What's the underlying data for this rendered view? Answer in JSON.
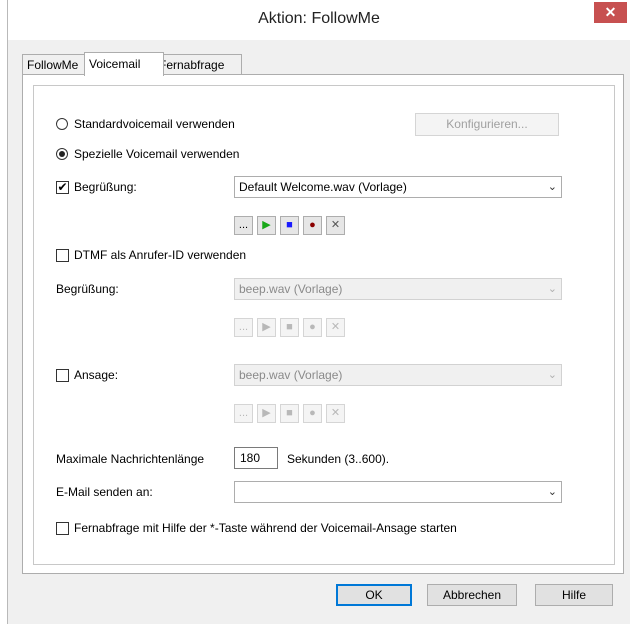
{
  "window": {
    "title": "Aktion: FollowMe",
    "close": "✕"
  },
  "tabs": [
    "FollowMe",
    "Voicemail",
    "Fernabfrage"
  ],
  "voicemail": {
    "radio_standard": "Standardvoicemail verwenden",
    "configure_button": "Konfigurieren...",
    "radio_special": "Spezielle Voicemail verwenden",
    "greeting1": {
      "label": "Begrüßung:",
      "checked": true,
      "value": "Default Welcome.wav (Vorlage)"
    },
    "dtmf_label": "DTMF als Anrufer-ID verwenden",
    "greeting2": {
      "label": "Begrüßung:",
      "value": "beep.wav (Vorlage)"
    },
    "announcement": {
      "label": "Ansage:",
      "value": "beep.wav (Vorlage)"
    },
    "max_length": {
      "label": "Maximale Nachrichtenlänge",
      "value": "180",
      "unit": "Sekunden (3..600)."
    },
    "email": {
      "label": "E-Mail senden an:",
      "value": ""
    },
    "remote_label": "Fernabfrage mit Hilfe der *-Taste während der Voicemail-Ansage starten"
  },
  "media_buttons": {
    "browse": "...",
    "play": "▶",
    "stop": "■",
    "record": "●",
    "delete": "✕"
  },
  "colors": {
    "play_active": "#17a817",
    "stop_active": "#1a1aff",
    "record_active": "#8b0000"
  },
  "footer": {
    "ok": "OK",
    "cancel": "Abbrechen",
    "help": "Hilfe"
  }
}
